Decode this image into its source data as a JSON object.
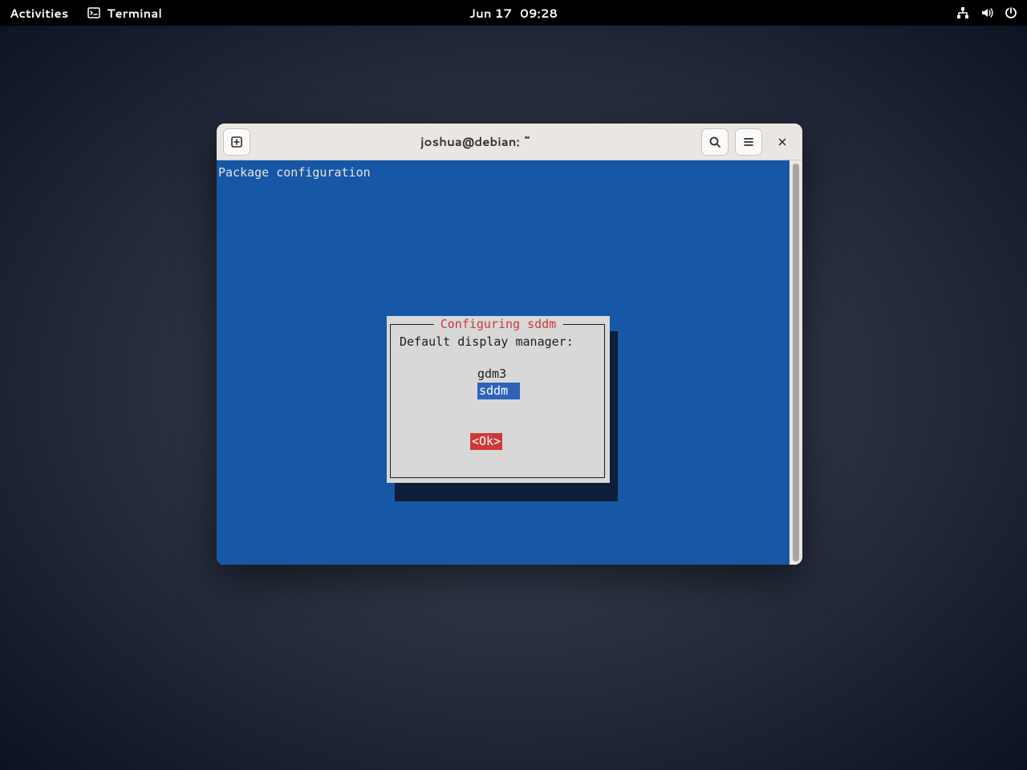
{
  "topbar": {
    "activities": "Activities",
    "app_name": "Terminal",
    "date": "Jun 17",
    "time": "09:28"
  },
  "window": {
    "title": "joshua@debian: ~"
  },
  "terminal": {
    "header_text": "Package configuration"
  },
  "dialog": {
    "title_label": "Configuring sddm",
    "prompt": "Default display manager:",
    "options": [
      "gdm3",
      "sddm"
    ],
    "selected_index": 1,
    "ok_label": "<Ok>"
  }
}
